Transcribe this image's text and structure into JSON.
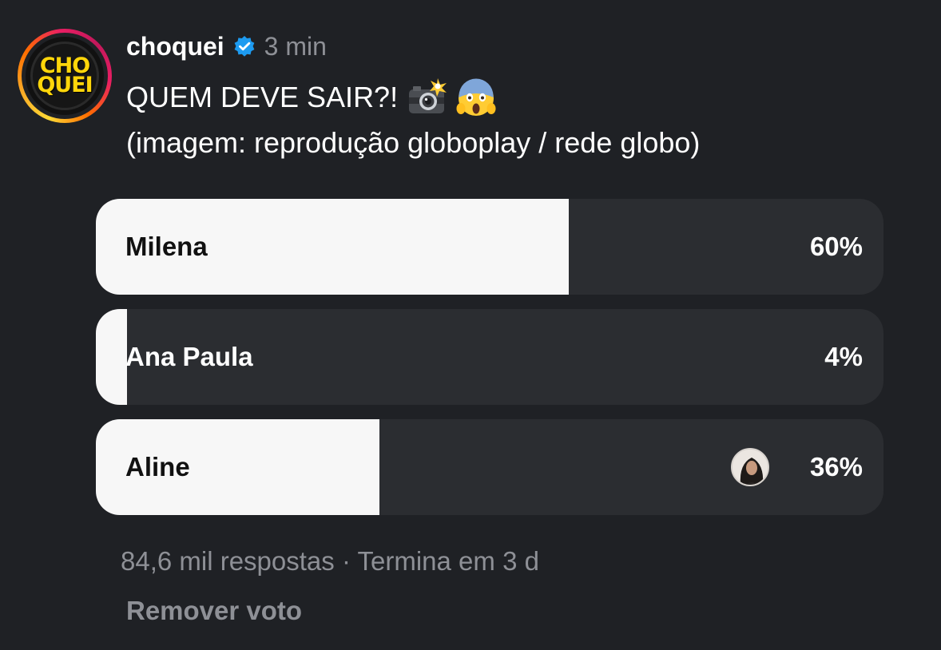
{
  "post": {
    "avatar": {
      "line1": "CHO",
      "line2": "QUEI",
      "ring_colors": [
        "#fdd835",
        "#ff6d00",
        "#e91e63"
      ]
    },
    "username": "choquei",
    "verified_icon": "verified-badge-icon",
    "timestamp": "3 min",
    "text_line1": "QUEM DEVE SAIR?!",
    "emojis": [
      "camera-with-flash-icon",
      "screaming-face-icon"
    ],
    "text_line2": "(imagem: reprodução globoplay / rede globo)"
  },
  "poll": {
    "options": [
      {
        "label": "Milena",
        "percent_label": "60%",
        "percent": 60,
        "voted": false
      },
      {
        "label": "Ana Paula",
        "percent_label": "4%",
        "percent": 4,
        "voted": false
      },
      {
        "label": "Aline",
        "percent_label": "36%",
        "percent": 36,
        "voted": true
      }
    ],
    "meta": "84,6 mil respostas · Termina em 3 d",
    "remove_vote": "Remover voto"
  },
  "colors": {
    "background": "#1f2125",
    "option_track": "#2b2d31",
    "fill": "#f7f7f7",
    "muted_text": "#8e9096",
    "verified_blue": "#1d9bf0"
  }
}
